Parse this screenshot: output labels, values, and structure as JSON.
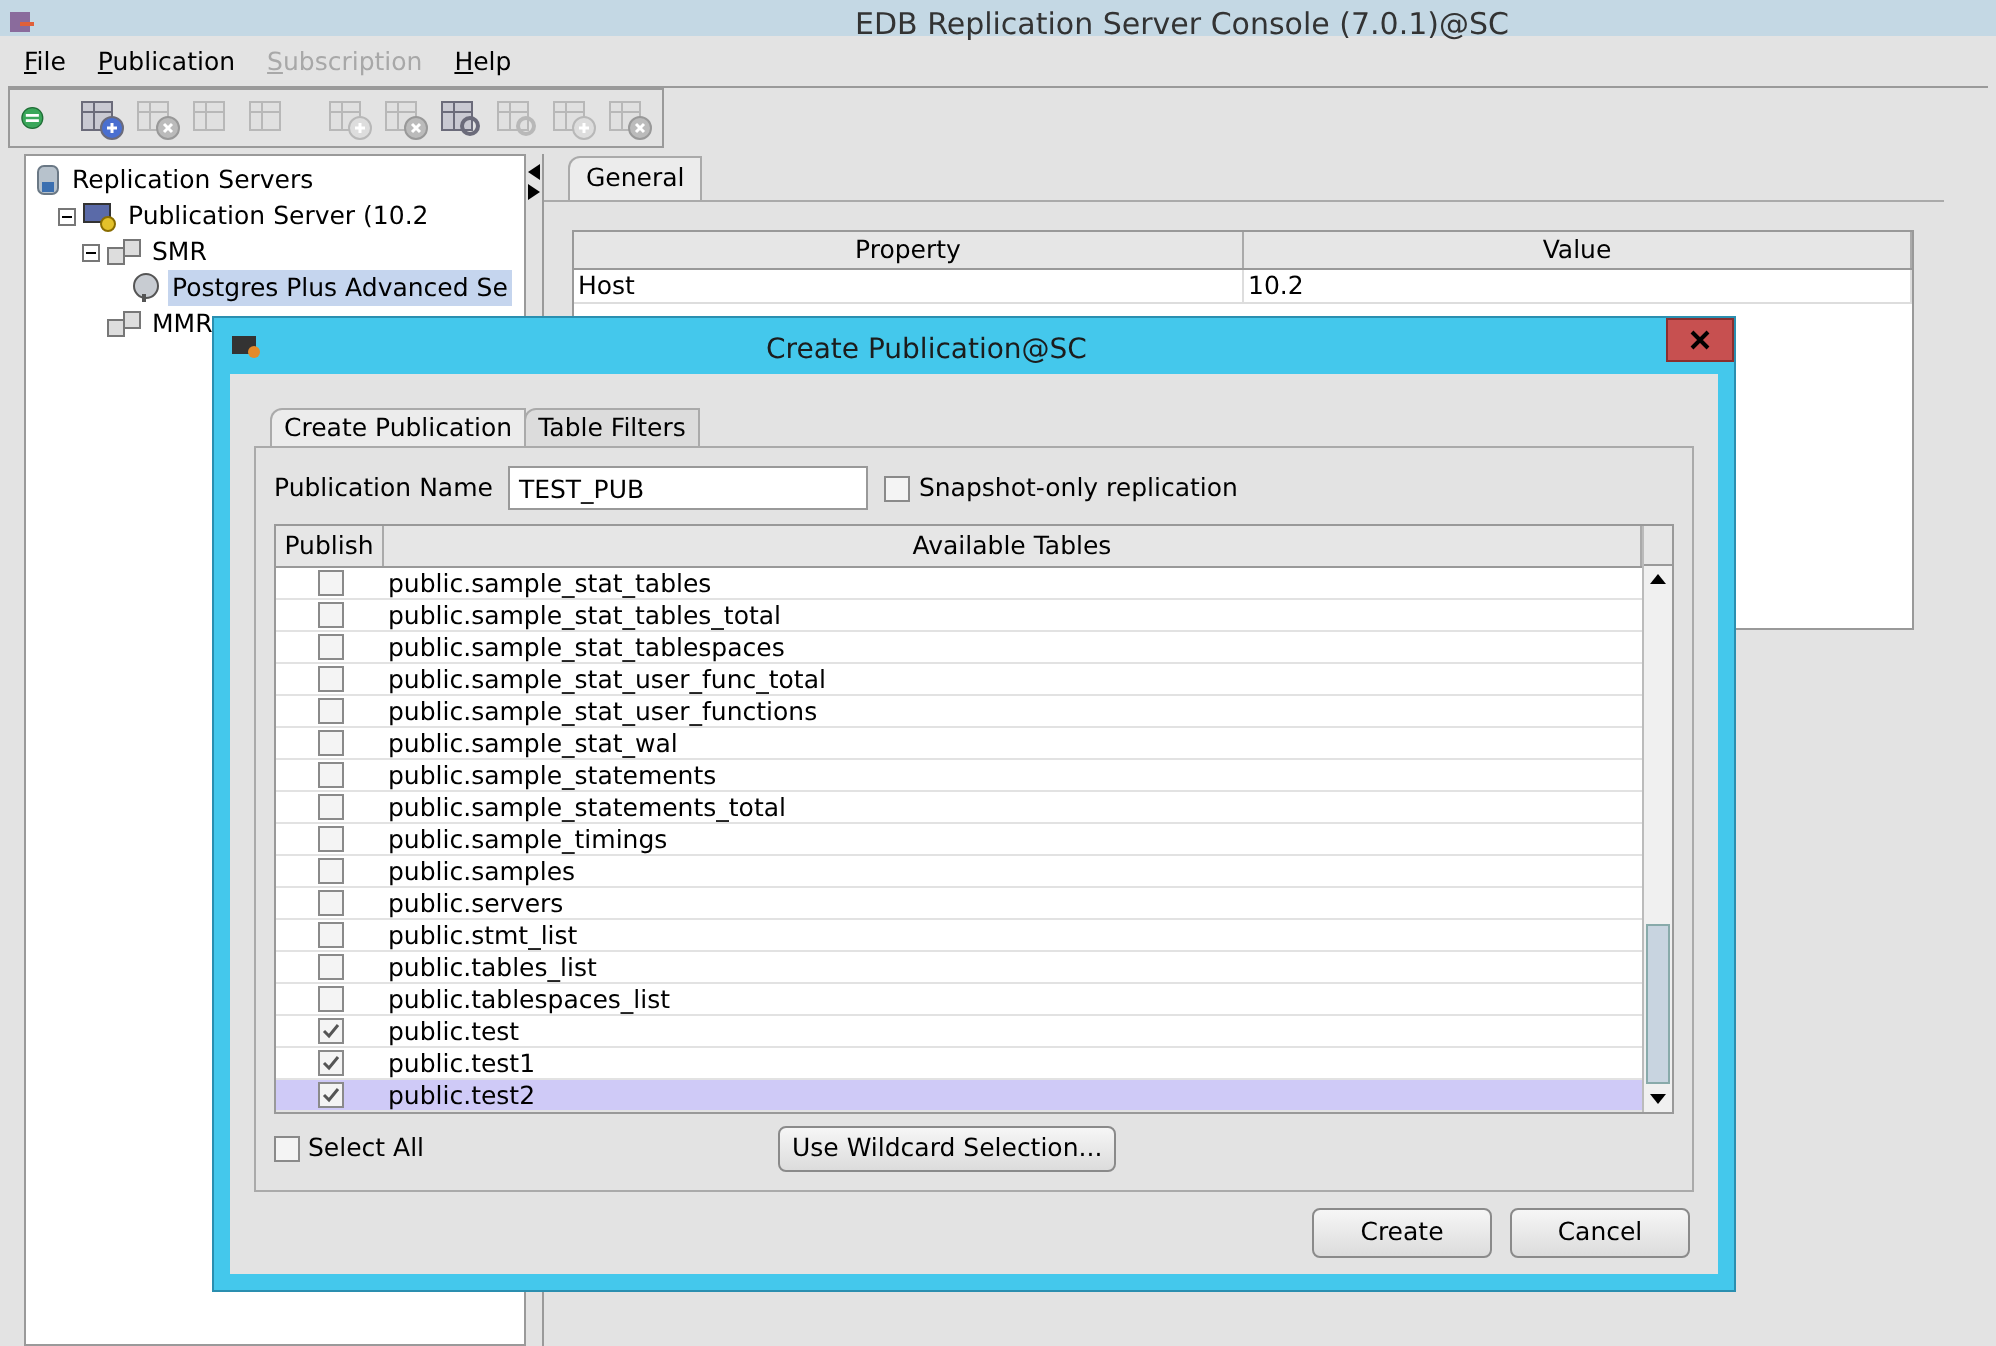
{
  "window": {
    "title": "EDB Replication Server Console (7.0.1)@SC"
  },
  "menu": [
    {
      "label": "File",
      "disabled": false
    },
    {
      "label": "Publication",
      "disabled": false
    },
    {
      "label": "Subscription",
      "disabled": true
    },
    {
      "label": "Help",
      "disabled": false
    }
  ],
  "tree": [
    {
      "label": "Replication Servers",
      "kind": "root",
      "selected": false,
      "children": [
        {
          "label": "Publication Server (10.2",
          "kind": "server",
          "selected": false,
          "children": [
            {
              "label": "SMR",
              "kind": "group",
              "selected": false,
              "children": [
                {
                  "label": "Postgres Plus Advanced Se",
                  "kind": "database",
                  "selected": true
                }
              ]
            },
            {
              "label": "MMR",
              "kind": "group",
              "selected": false
            }
          ]
        }
      ]
    }
  ],
  "details": {
    "tabs": [
      {
        "label": "General",
        "selected": true
      }
    ],
    "columns": [
      "Property",
      "Value"
    ],
    "rows": [
      [
        "Host",
        "10.2"
      ]
    ]
  },
  "dialog": {
    "title": "Create Publication@SC",
    "tabs": [
      {
        "label": "Create Publication",
        "selected": true
      },
      {
        "label": "Table Filters",
        "selected": false
      }
    ],
    "publication_name": {
      "label": "Publication Name",
      "value": "TEST_PUB"
    },
    "snapshot_only": {
      "label": "Snapshot-only replication",
      "checked": false
    },
    "table": {
      "columns": [
        "Publish",
        "Available Tables"
      ],
      "rows": [
        {
          "name": "public.sample_stat_tables",
          "checked": false,
          "selected": false
        },
        {
          "name": "public.sample_stat_tables_total",
          "checked": false,
          "selected": false
        },
        {
          "name": "public.sample_stat_tablespaces",
          "checked": false,
          "selected": false
        },
        {
          "name": "public.sample_stat_user_func_total",
          "checked": false,
          "selected": false
        },
        {
          "name": "public.sample_stat_user_functions",
          "checked": false,
          "selected": false
        },
        {
          "name": "public.sample_stat_wal",
          "checked": false,
          "selected": false
        },
        {
          "name": "public.sample_statements",
          "checked": false,
          "selected": false
        },
        {
          "name": "public.sample_statements_total",
          "checked": false,
          "selected": false
        },
        {
          "name": "public.sample_timings",
          "checked": false,
          "selected": false
        },
        {
          "name": "public.samples",
          "checked": false,
          "selected": false
        },
        {
          "name": "public.servers",
          "checked": false,
          "selected": false
        },
        {
          "name": "public.stmt_list",
          "checked": false,
          "selected": false
        },
        {
          "name": "public.tables_list",
          "checked": false,
          "selected": false
        },
        {
          "name": "public.tablespaces_list",
          "checked": false,
          "selected": false
        },
        {
          "name": "public.test",
          "checked": true,
          "selected": false
        },
        {
          "name": "public.test1",
          "checked": true,
          "selected": false
        },
        {
          "name": "public.test2",
          "checked": true,
          "selected": true
        }
      ]
    },
    "select_all": {
      "label": "Select All",
      "checked": false
    },
    "wildcard_button": "Use Wildcard Selection...",
    "buttons": [
      "Create",
      "Cancel"
    ]
  }
}
